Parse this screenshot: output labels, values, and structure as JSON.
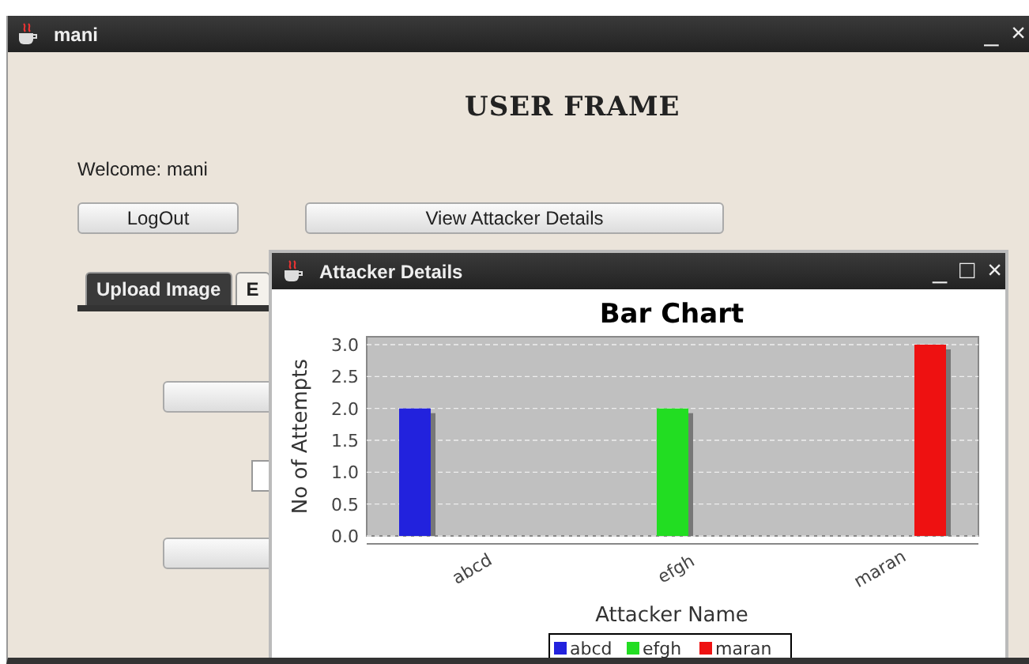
{
  "window": {
    "title": "mani",
    "controls": [
      "_",
      "×"
    ]
  },
  "heading": "USER FRAME",
  "welcome": "Welcome: mani",
  "buttons": [
    "LogOut",
    "View Attacker Details"
  ],
  "tabs": [
    {
      "label": "Upload Image",
      "selected": true
    },
    {
      "label": "E",
      "selected": false
    }
  ],
  "dialog": {
    "title": "Attacker Details",
    "controls": [
      "_",
      "□",
      "×"
    ],
    "chart_data": {
      "type": "bar",
      "title": "Bar Chart",
      "xlabel": "Attacker Name",
      "ylabel": "No of Attempts",
      "categories": [
        "abcd",
        "efgh",
        "maran"
      ],
      "series": [
        {
          "name": "abcd",
          "color": "#2222dd",
          "values": [
            2,
            null,
            null
          ]
        },
        {
          "name": "efgh",
          "color": "#22dd22",
          "values": [
            null,
            2,
            null
          ]
        },
        {
          "name": "maran",
          "color": "#ee1111",
          "values": [
            null,
            null,
            3
          ]
        }
      ],
      "ylim": [
        0,
        3
      ],
      "grid": true,
      "legend": "bottom",
      "yticks": [
        {
          "value": 0,
          "label": "0.0"
        },
        {
          "value": 0.5,
          "label": "0.5"
        },
        {
          "value": 1,
          "label": "1.0"
        },
        {
          "value": 1.5,
          "label": "1.5"
        },
        {
          "value": 2,
          "label": "2.0"
        },
        {
          "value": 2.5,
          "label": "2.5"
        },
        {
          "value": 3,
          "label": "3.0"
        }
      ]
    }
  }
}
